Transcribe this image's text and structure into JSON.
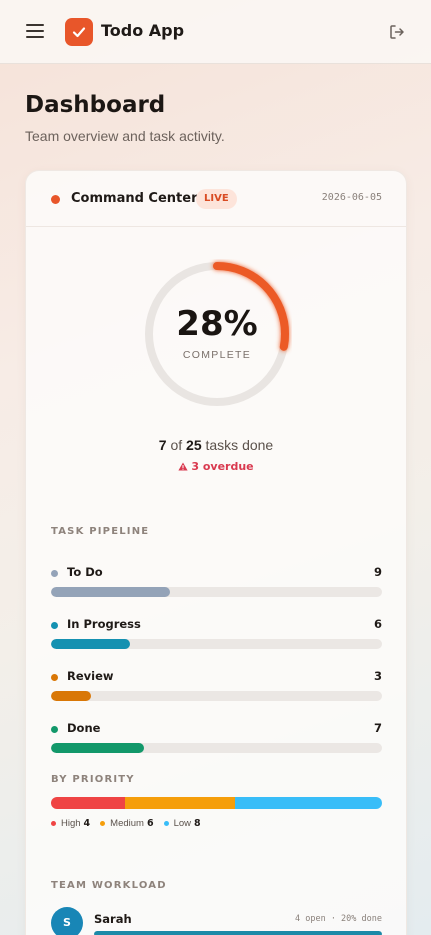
{
  "header": {
    "app_title": "Todo App",
    "menu_icon": "hamburger-menu-icon",
    "logo_icon": "checkmark-icon",
    "logout_icon": "logout-icon",
    "accent_color": "#e8562a"
  },
  "page": {
    "title": "Dashboard",
    "subtitle": "Team overview and task activity."
  },
  "card": {
    "title": "Command Center",
    "badge": "LIVE",
    "date": "2026-06-05",
    "progress": {
      "percent_label": "28%",
      "percent_value": 28,
      "label": "COMPLETE",
      "done": "7",
      "of_word": "of",
      "total": "25",
      "suffix": "tasks done",
      "overdue": "3 overdue"
    },
    "pipeline": {
      "label": "TASK PIPELINE",
      "items": [
        {
          "name": "To Do",
          "count": "9",
          "fraction": 0.36,
          "color": "#94a3b8"
        },
        {
          "name": "In Progress",
          "count": "6",
          "fraction": 0.24,
          "color": "#1591b1"
        },
        {
          "name": "Review",
          "count": "3",
          "fraction": 0.12,
          "color": "#d97706"
        },
        {
          "name": "Done",
          "count": "7",
          "fraction": 0.28,
          "color": "#12986a"
        }
      ]
    },
    "priority": {
      "label": "BY PRIORITY",
      "items": [
        {
          "name": "High",
          "count": "4",
          "value": 4,
          "color": "#ef4444"
        },
        {
          "name": "Medium",
          "count": "6",
          "value": 6,
          "color": "#f59e0b"
        },
        {
          "name": "Low",
          "count": "8",
          "value": 8,
          "color": "#38bdf8"
        }
      ]
    },
    "workload": {
      "label": "TEAM WORKLOAD",
      "members": [
        {
          "initial": "S",
          "name": "Sarah",
          "stats": "4 open · 20% done",
          "fraction": 1.0
        }
      ]
    }
  }
}
